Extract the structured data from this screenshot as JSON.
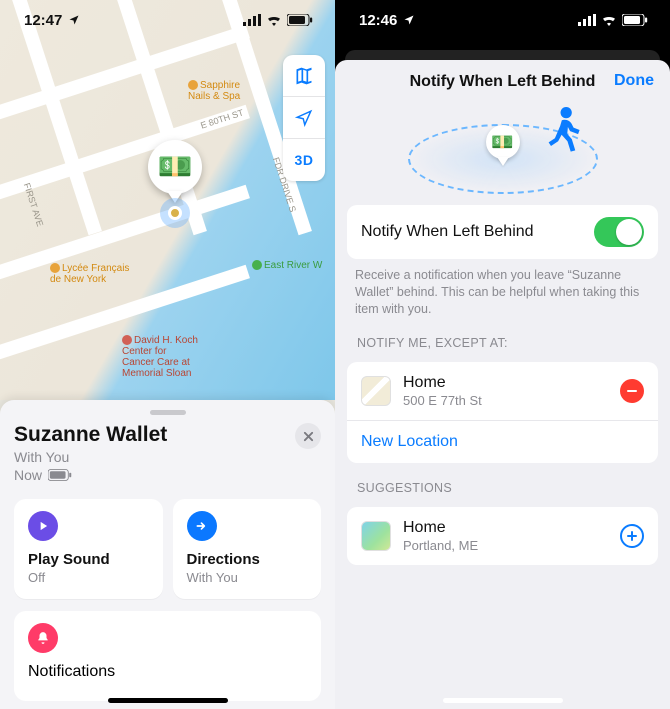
{
  "left": {
    "status": {
      "time": "12:47"
    },
    "map": {
      "poi_spa": "Sapphire\nNails & Spa",
      "poi_park": "East River W",
      "poi_hosp": "David H. Koch\nCenter for\nCancer Care at\nMemorial Sloan",
      "poi_school": "Lycée Français\nde New York",
      "street_e80": "E 80TH ST",
      "street_1st": "FIRST AVE",
      "street_fdr": "FDR DRIVE S",
      "controls": {
        "threeD": "3D"
      },
      "pin_emoji": "💵"
    },
    "card": {
      "title": "Suzanne Wallet",
      "status": "With You",
      "time": "Now",
      "tile_play": {
        "label": "Play Sound",
        "sub": "Off"
      },
      "tile_dir": {
        "label": "Directions",
        "sub": "With You"
      },
      "tile_notif": {
        "label": "Notifications"
      }
    }
  },
  "right": {
    "status": {
      "time": "12:46"
    },
    "modal": {
      "title": "Notify When Left Behind",
      "done": "Done",
      "pin_emoji": "💵",
      "toggle": {
        "label": "Notify When Left Behind",
        "on": true
      },
      "explain": "Receive a notification when you leave “Suzanne Wallet” behind. This can be helpful when taking this item with you.",
      "sect_except": "NOTIFY ME, EXCEPT AT:",
      "except": [
        {
          "title": "Home",
          "sub": "500 E 77th St"
        }
      ],
      "new_location": "New Location",
      "sect_sugg": "SUGGESTIONS",
      "sugg": [
        {
          "title": "Home",
          "sub": "Portland, ME"
        }
      ]
    }
  }
}
